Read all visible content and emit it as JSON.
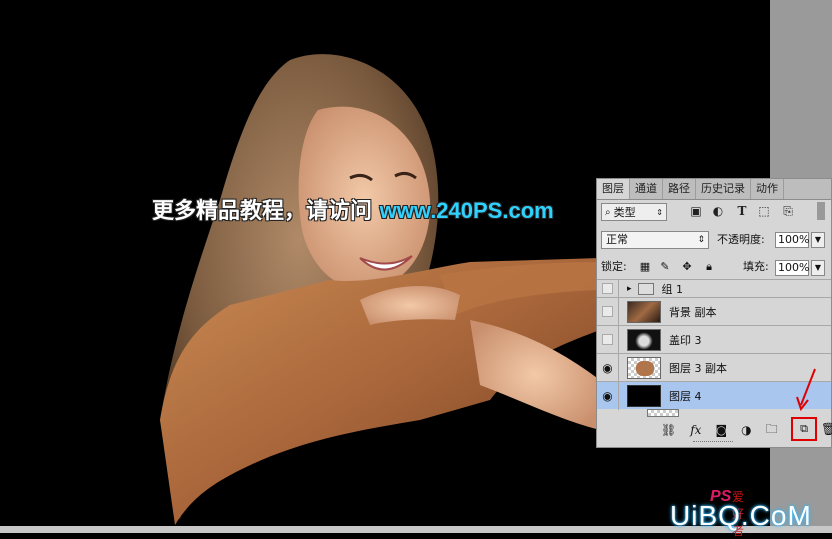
{
  "watermark": {
    "text_cn": "更多精品教程，请访问 ",
    "url": "www.240PS.com"
  },
  "tabs": [
    "图层",
    "通道",
    "路径",
    "历史记录",
    "动作"
  ],
  "filter": {
    "label": "类型"
  },
  "blend_mode": "正常",
  "opacity": {
    "label": "不透明度:",
    "value": "100%"
  },
  "lock_label": "锁定:",
  "fill": {
    "label": "填充:",
    "value": "100%"
  },
  "layers": [
    {
      "name": "组 1",
      "visible": false
    },
    {
      "name": "背景 副本",
      "visible": false
    },
    {
      "name": "盖印 3",
      "visible": false
    },
    {
      "name": "图层 3 副本",
      "visible": true
    },
    {
      "name": "图层 4",
      "visible": true,
      "selected": true
    }
  ],
  "footer_icons": [
    "link-icon",
    "fx-icon",
    "mask-icon",
    "adjustment-icon",
    "folder-icon",
    "new-layer-icon",
    "trash-icon"
  ],
  "footer_fx": "fx",
  "site_logo": {
    "ps": "PS",
    "ps_cn": "爱好者",
    "uibo": "UiBQ.CoM"
  },
  "colors": {
    "selected_layer": "#a9c6ee",
    "highlight_box": "#e00000",
    "url": "#2fd2ff"
  }
}
